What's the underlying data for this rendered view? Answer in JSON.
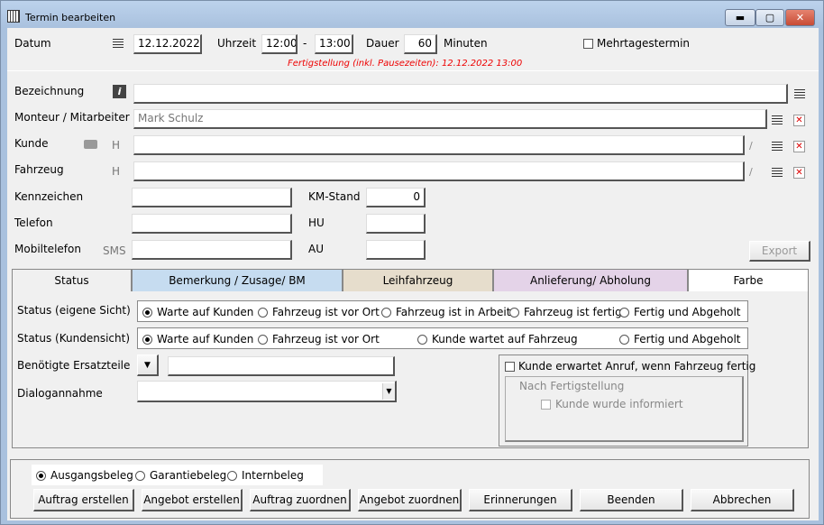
{
  "window": {
    "title": "Termin bearbeiten",
    "minimize": "▬",
    "maximize": "▢",
    "close": "✕"
  },
  "datetime": {
    "date_label": "Datum",
    "date": "12.12.2022",
    "time_label": "Uhrzeit",
    "start": "12:00",
    "dash": "-",
    "end": "13:00",
    "duration_label": "Dauer",
    "duration": "60",
    "unit": "Minuten",
    "multiday_label": "Mehrtagestermin",
    "completion": "Fertigstellung (inkl. Pausezeiten): 12.12.2022 13:00"
  },
  "fields": {
    "description_label": "Bezeichnung",
    "mechanic_label": "Monteur / Mitarbeiter",
    "mechanic": "Mark Schulz",
    "customer_label": "Kunde",
    "customer_h": "H",
    "vehicle_label": "Fahrzeug",
    "vehicle_h": "H",
    "plate_label": "Kennzeichen",
    "km_label": "KM-Stand",
    "km": "0",
    "phone_label": "Telefon",
    "hu_label": "HU",
    "mobile_label": "Mobiltelefon",
    "sms_label": "SMS",
    "au_label": "AU",
    "export": "Export",
    "info_glyph": "i",
    "x_glyph": "✕",
    "pen_glyph": "∕"
  },
  "tabs": [
    {
      "label": "Status",
      "color": "#f0f0f0"
    },
    {
      "label": "Bemerkung / Zusage/ BM",
      "color": "#c6dcf0"
    },
    {
      "label": "Leihfahrzeug",
      "color": "#e6ddcc"
    },
    {
      "label": "Anlieferung/ Abholung",
      "color": "#e4d3e8"
    },
    {
      "label": "Farbe",
      "color": "#ffffff"
    }
  ],
  "status": {
    "own_label": "Status (eigene Sicht)",
    "own_options": [
      "Warte auf Kunden",
      "Fahrzeug ist vor Ort",
      "Fahrzeug ist in Arbeit",
      "Fahrzeug ist fertig",
      "Fertig und Abgeholt"
    ],
    "customer_label": "Status (Kundensicht)",
    "customer_options": [
      "Warte auf Kunden",
      "Fahrzeug ist vor Ort",
      "Kunde wartet auf Fahrzeug",
      "Fertig und Abgeholt"
    ],
    "parts_label": "Benötigte Ersatzteile",
    "dialog_label": "Dialogannahme",
    "call_label": "Kunde erwartet Anruf, wenn Fahrzeug fertig",
    "after_label": "Nach Fertigstellung",
    "informed_label": "Kunde wurde informiert",
    "dd_glyph": "▼"
  },
  "document": {
    "options": [
      "Ausgangsbeleg",
      "Garantiebeleg",
      "Internbeleg"
    ]
  },
  "buttons": [
    "Auftrag erstellen",
    "Angebot erstellen",
    "Auftrag zuordnen",
    "Angebot zuordnen",
    "Erinnerungen",
    "Beenden",
    "Abbrechen"
  ]
}
